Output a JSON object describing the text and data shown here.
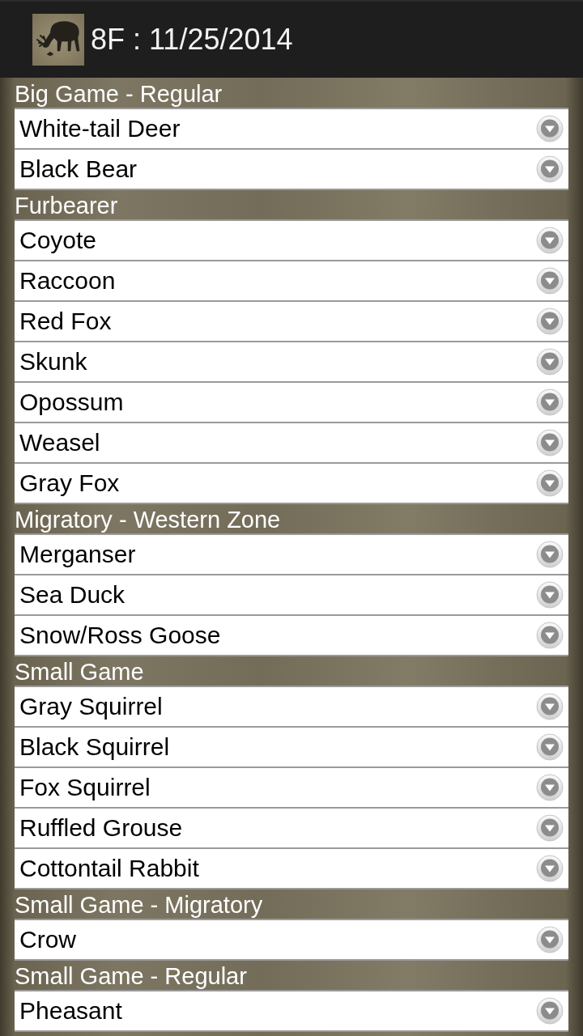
{
  "app_bar": {
    "title": "8F : 11/25/2014"
  },
  "sections": [
    {
      "title": "Big Game - Regular",
      "items": [
        {
          "label": "White-tail Deer"
        },
        {
          "label": "Black Bear"
        }
      ]
    },
    {
      "title": "Furbearer",
      "items": [
        {
          "label": "Coyote"
        },
        {
          "label": "Raccoon"
        },
        {
          "label": "Red Fox"
        },
        {
          "label": "Skunk"
        },
        {
          "label": "Opossum"
        },
        {
          "label": "Weasel"
        },
        {
          "label": "Gray Fox"
        }
      ]
    },
    {
      "title": "Migratory - Western Zone",
      "items": [
        {
          "label": "Merganser"
        },
        {
          "label": "Sea Duck"
        },
        {
          "label": "Snow/Ross Goose"
        }
      ]
    },
    {
      "title": "Small Game",
      "items": [
        {
          "label": "Gray Squirrel"
        },
        {
          "label": "Black Squirrel"
        },
        {
          "label": "Fox Squirrel"
        },
        {
          "label": "Ruffled Grouse"
        },
        {
          "label": "Cottontail Rabbit"
        }
      ]
    },
    {
      "title": "Small Game - Migratory",
      "items": [
        {
          "label": "Crow"
        }
      ]
    },
    {
      "title": "Small Game - Regular",
      "items": [
        {
          "label": "Pheasant"
        }
      ]
    }
  ]
}
